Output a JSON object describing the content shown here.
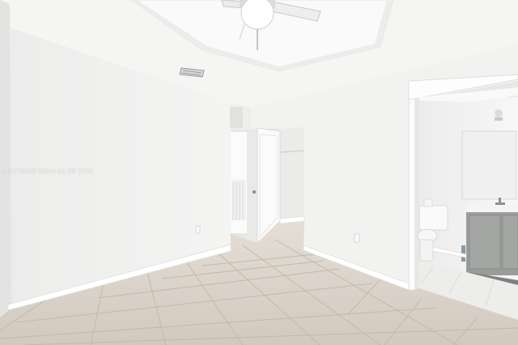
{
  "watermark": "A1177626© Miami MLS® 2025",
  "colors": {
    "wall": "#f3f3f2",
    "wall_shadow": "#e8e8e7",
    "ceiling": "#f6f6f5",
    "floor_tile": "#d8d1c7",
    "grout": "#bfb6aa",
    "baseboard": "#ffffff",
    "vanity": "#9a9c9a",
    "bathroom_floor": "#eeeeec"
  },
  "icons": [
    "ceiling-fan-icon",
    "air-vent-icon",
    "light-switch-icon",
    "outlet-icon",
    "toilet-icon",
    "vanity-icon",
    "faucet-icon"
  ]
}
